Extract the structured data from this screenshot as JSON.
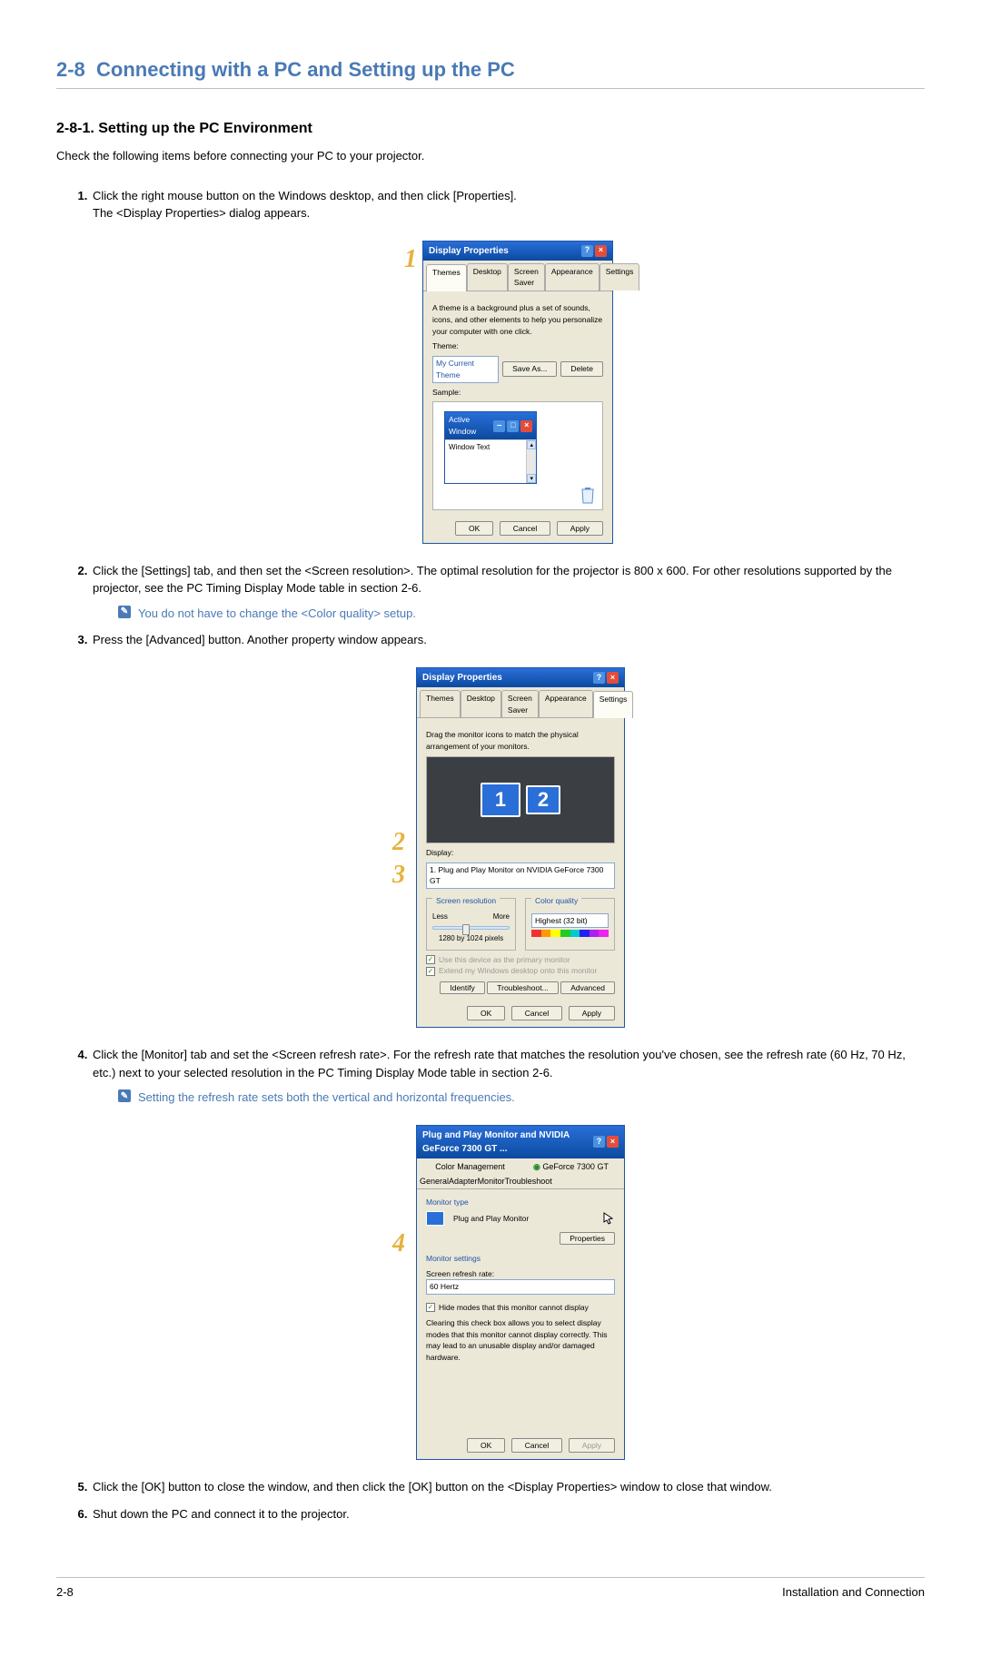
{
  "section": {
    "number": "2-8",
    "title": "Connecting with a PC and Setting up the PC"
  },
  "subsection": {
    "number": "2-8-1.",
    "title": "Setting up the PC Environment",
    "intro": "Check the following items before connecting your PC to your projector."
  },
  "steps": {
    "s1a": "Click the right mouse button on the Windows desktop, and then click [Properties].",
    "s1b": "The <Display Properties> dialog appears.",
    "s2": "Click the [Settings] tab, and then set the <Screen resolution>. The optimal resolution for the projector is 800 x 600. For other resolutions supported by the projector, see the PC Timing Display Mode table in section 2-6.",
    "note2": "You do not have to change the <Color quality> setup.",
    "s3": "Press the [Advanced] button. Another property window appears.",
    "s4": "Click the [Monitor] tab and set the <Screen refresh rate>. For the refresh rate that matches the resolution you've chosen, see the refresh rate (60 Hz, 70 Hz, etc.) next to your selected resolution in the PC Timing Display Mode table in section 2-6.",
    "note4": "Setting the refresh rate sets both the vertical and horizontal frequencies.",
    "s5": "Click the [OK] button to close the window, and then click the [OK] button on the <Display Properties> window to close that window.",
    "s6": "Shut down the PC and connect it to the projector."
  },
  "callouts": {
    "c1": "1",
    "c2": "2",
    "c3": "3",
    "c4": "4"
  },
  "dlg1": {
    "title": "Display Properties",
    "tabs": {
      "t1": "Themes",
      "t2": "Desktop",
      "t3": "Screen Saver",
      "t4": "Appearance",
      "t5": "Settings"
    },
    "desc": "A theme is a background plus a set of sounds, icons, and other elements to help you personalize your computer with one click.",
    "theme_label": "Theme:",
    "theme_value": "My Current Theme",
    "saveas": "Save As...",
    "delete": "Delete",
    "sample": "Sample:",
    "aw_title": "Active Window",
    "aw_text": "Window Text",
    "ok": "OK",
    "cancel": "Cancel",
    "apply": "Apply"
  },
  "dlg2": {
    "title": "Display Properties",
    "tabs": {
      "t1": "Themes",
      "t2": "Desktop",
      "t3": "Screen Saver",
      "t4": "Appearance",
      "t5": "Settings"
    },
    "drag": "Drag the monitor icons to match the physical arrangement of your monitors.",
    "display_label": "Display:",
    "display_value": "1. Plug and Play Monitor on NVIDIA GeForce 7300 GT",
    "res_legend": "Screen resolution",
    "less": "Less",
    "more": "More",
    "res_value": "1280 by 1024 pixels",
    "cq_legend": "Color quality",
    "cq_value": "Highest (32 bit)",
    "chk1": "Use this device as the primary monitor",
    "chk2": "Extend my Windows desktop onto this monitor",
    "identify": "Identify",
    "trouble": "Troubleshoot...",
    "advanced": "Advanced",
    "ok": "OK",
    "cancel": "Cancel",
    "apply": "Apply",
    "m1": "1",
    "m2": "2"
  },
  "dlg3": {
    "title": "Plug and Play Monitor and NVIDIA GeForce 7300 GT ...",
    "tabs": {
      "t1": "Color Management",
      "t2": "GeForce 7300 GT",
      "t3": "General",
      "t4": "Adapter",
      "t5": "Monitor",
      "t6": "Troubleshoot"
    },
    "mt_legend": "Monitor type",
    "mt_value": "Plug and Play Monitor",
    "properties": "Properties",
    "ms_legend": "Monitor settings",
    "sr_label": "Screen refresh rate:",
    "sr_value": "60 Hertz",
    "hide_label": "Hide modes that this monitor cannot display",
    "hide_desc": "Clearing this check box allows you to select display modes that this monitor cannot display correctly. This may lead to an unusable display and/or damaged hardware.",
    "ok": "OK",
    "cancel": "Cancel",
    "apply": "Apply"
  },
  "footer": {
    "left": "2-8",
    "right": "Installation and Connection"
  }
}
